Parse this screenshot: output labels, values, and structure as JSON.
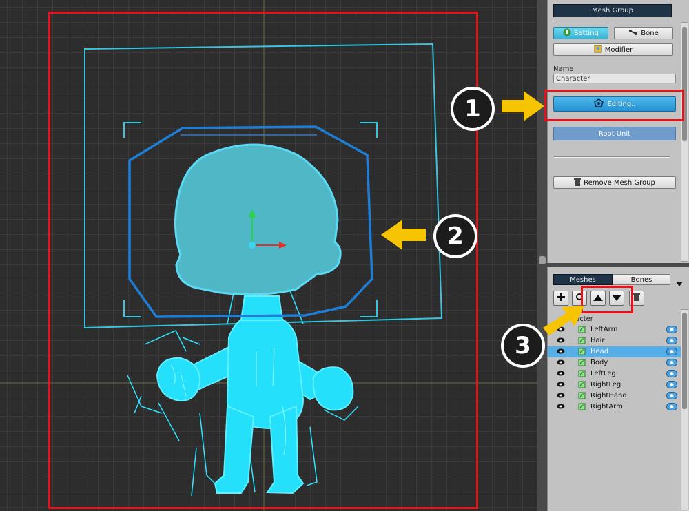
{
  "panel": {
    "title": "Mesh Group",
    "setting_label": "Setting",
    "bone_label": "Bone",
    "modifier_label": "Modifier",
    "name_label": "Name",
    "name_value": "Character",
    "editing_label": "Editing..",
    "root_unit_label": "Root Unit",
    "remove_label": "Remove Mesh Group"
  },
  "hierarchy": {
    "tab_meshes": "Meshes",
    "tab_bones": "Bones",
    "root_label": "racter",
    "items": [
      {
        "name": "LeftArm",
        "selected": false
      },
      {
        "name": "Hair",
        "selected": false
      },
      {
        "name": "Head",
        "selected": true
      },
      {
        "name": "Body",
        "selected": false
      },
      {
        "name": "LeftLeg",
        "selected": false
      },
      {
        "name": "RightLeg",
        "selected": false
      },
      {
        "name": "RightHand",
        "selected": false
      },
      {
        "name": "RightArm",
        "selected": false
      }
    ]
  },
  "callouts": {
    "one": "1",
    "two": "2",
    "three": "3"
  },
  "colors": {
    "highlight_red": "#e3141c",
    "arrow_yellow": "#f6c400",
    "mesh_cyan": "#2ee6ff",
    "selection_blue": "#57aee6"
  }
}
